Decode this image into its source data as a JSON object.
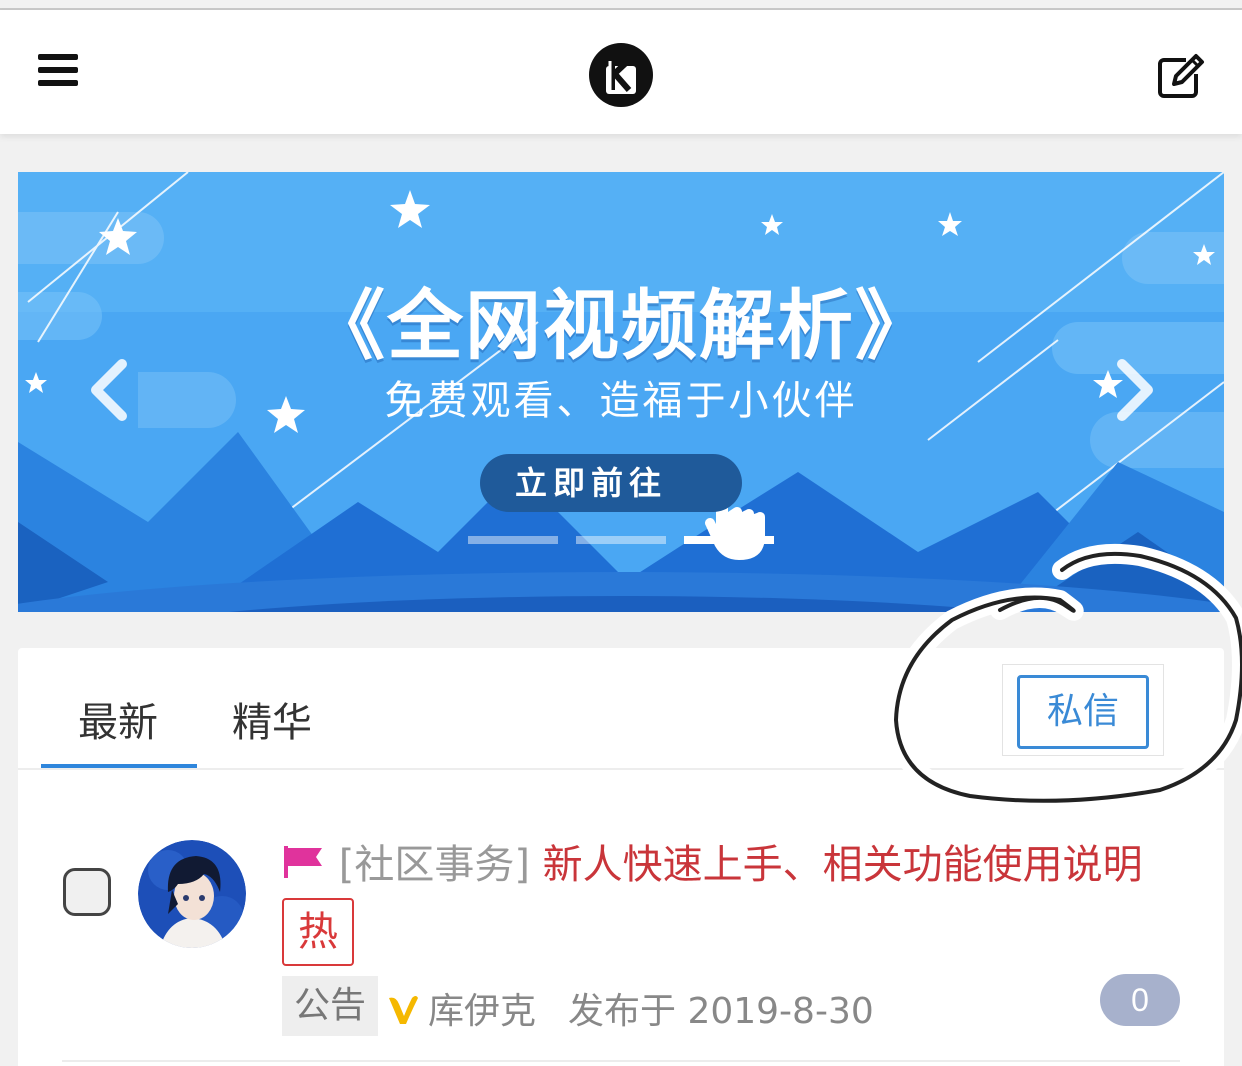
{
  "header": {
    "menu_icon": "hamburger-menu-icon",
    "logo_icon": "k-logo-icon",
    "edit_icon": "compose-edit-icon"
  },
  "banner": {
    "title": "《全网视频解析》",
    "subtitle": "免费观看、造福于小伙伴",
    "cta_label": "立即前往",
    "prev_icon": "chevron-left-icon",
    "next_icon": "chevron-right-icon",
    "slides": 3,
    "active_slide": 3,
    "colors": {
      "sky": "#4aa7f3",
      "mountain": "#1f6fd4",
      "button": "#1f5a9a"
    }
  },
  "tabs": {
    "items": [
      "最新",
      "精华"
    ],
    "active": "最新",
    "pm_button_label": "私信"
  },
  "posts": [
    {
      "category": "[社区事务]",
      "title": "新人快速上手、相关功能使用说明",
      "hot_label": "热",
      "tag": "公告",
      "author": "库伊克",
      "published": "发布于 2019-8-30",
      "reply_count": "0",
      "colors": {
        "title": "#c9353a",
        "flag": "#e0339c",
        "vip": "#f5b800"
      }
    }
  ]
}
